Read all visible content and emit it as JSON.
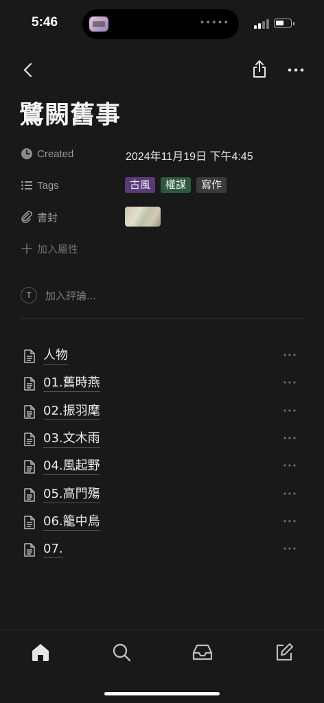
{
  "status_bar": {
    "time": "5:46",
    "island_dots": "•••••"
  },
  "page": {
    "title": "鷺闕舊事"
  },
  "properties": {
    "created": {
      "label": "Created",
      "value": "2024年11月19日 下午4:45"
    },
    "tags": {
      "label": "Tags",
      "items": [
        {
          "label": "古風",
          "color": "#5a3a78"
        },
        {
          "label": "權謀",
          "color": "#2b5a3c"
        },
        {
          "label": "寫作",
          "color": "#3a3a3a"
        }
      ]
    },
    "cover": {
      "label": "書封"
    },
    "add_property": {
      "label": "加入屬性"
    }
  },
  "comment": {
    "avatar": "T",
    "placeholder": "加入評論..."
  },
  "subpages": [
    {
      "label": "人物"
    },
    {
      "label": "01.舊時燕"
    },
    {
      "label": "02.振羽麾"
    },
    {
      "label": "03.文木雨"
    },
    {
      "label": "04.風起野"
    },
    {
      "label": "05.高門殤"
    },
    {
      "label": "06.籠中鳥"
    },
    {
      "label": "07."
    }
  ],
  "tab_bar": {
    "items": [
      {
        "name": "home-icon"
      },
      {
        "name": "search-icon"
      },
      {
        "name": "inbox-icon"
      },
      {
        "name": "new-page-icon"
      }
    ]
  },
  "colors": {
    "background": "#191919",
    "text": "#e6e6e6",
    "muted": "#9b9b9b"
  }
}
